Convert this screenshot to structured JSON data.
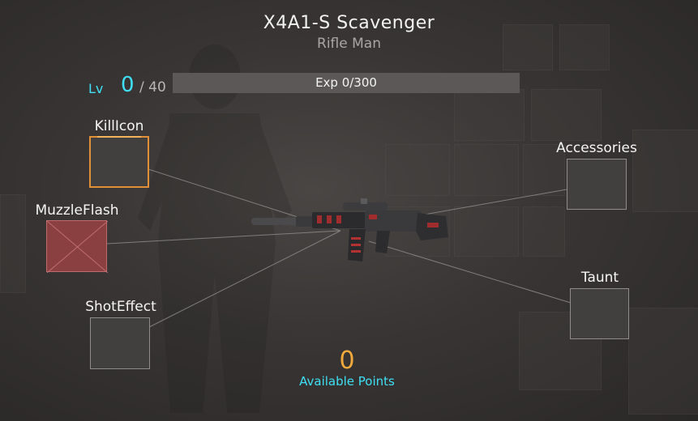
{
  "header": {
    "title": "X4A1-S Scavenger",
    "subtitle": "Rifle Man"
  },
  "level": {
    "label": "Lv",
    "current": "0",
    "max": "/ 40"
  },
  "experience": {
    "text": "Exp 0/300",
    "progress_fraction": 0
  },
  "slots": {
    "kill_icon": {
      "label": "KillIcon",
      "state": "selected"
    },
    "muzzle_flash": {
      "label": "MuzzleFlash",
      "state": "locked"
    },
    "shot_effect": {
      "label": "ShotEffect",
      "state": "empty"
    },
    "accessories": {
      "label": "Accessories",
      "state": "empty"
    },
    "taunt": {
      "label": "Taunt",
      "state": "empty"
    }
  },
  "points": {
    "value": "0",
    "label": "Available Points"
  },
  "colors": {
    "accent_cyan": "#3fe0f5",
    "points_orange": "#f0a93a",
    "selected_border": "#e1903a",
    "locked_red": "#8a3f41"
  },
  "weapon": {
    "icon": "assault-rifle-icon"
  }
}
